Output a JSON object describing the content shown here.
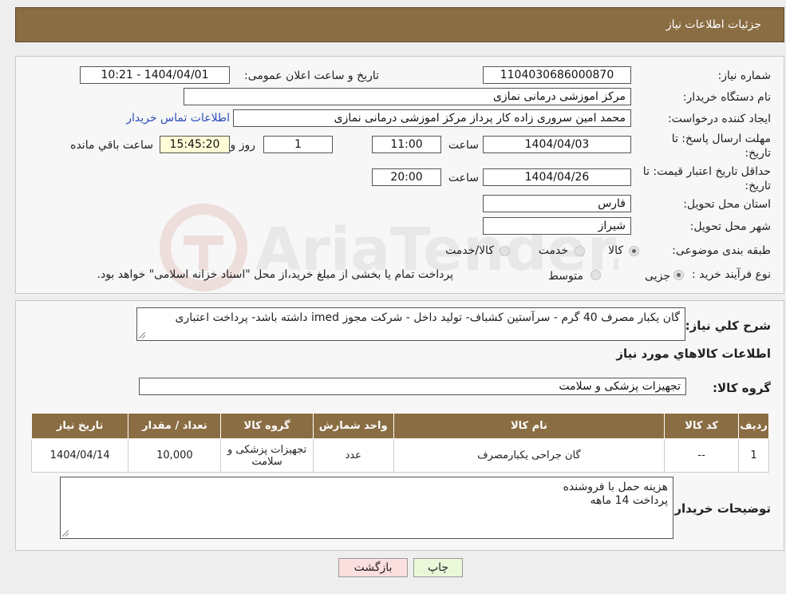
{
  "header": {
    "title": "جزئیات اطلاعات نیاز"
  },
  "form": {
    "need_number_label": "شماره نیاز:",
    "need_number": "1104030686000870",
    "announce_label": "تاریخ و ساعت اعلان عمومی:",
    "announce_value": "1404/04/01 - 10:21",
    "buyer_org_label": "نام دستگاه خریدار:",
    "buyer_org": "مرکز اموزشی درمانی نمازی",
    "requester_label": "ایجاد کننده درخواست:",
    "requester": "محمد امین سروری زاده کار پرداز مرکز اموزشی درمانی نمازی",
    "contact_link": "اطلاعات تماس خریدار",
    "reply_deadline_label": "مهلت ارسال پاسخ: تا تاریخ:",
    "reply_date": "1404/04/03",
    "time_label": "ساعت",
    "reply_time": "11:00",
    "days_value": "1",
    "days_label": "روز و",
    "remaining_time": "15:45:20",
    "remaining_label": "ساعت باقي مانده",
    "price_validity_label": "حداقل تاریخ اعتبار قیمت: تا تاریخ:",
    "validity_date": "1404/04/26",
    "validity_time": "20:00",
    "province_label": "استان محل تحویل:",
    "province": "فارس",
    "city_label": "شهر محل تحویل:",
    "city": "شیراز",
    "category_label": "طبقه بندی موضوعی:",
    "category_options": [
      "کالا",
      "خدمت",
      "کالا/خدمت"
    ],
    "process_label": "نوع فرآیند خرید :",
    "process_options": [
      "جزیی",
      "متوسط"
    ],
    "process_note": "پرداخت تمام یا بخشی از مبلغ خرید،از محل \"اسناد خزانه اسلامی\" خواهد بود."
  },
  "description": {
    "label": "شرح کلي نياز:",
    "text": "گان یکبار مصرف 40 گرم - سرآستین کشباف- تولید داخل - شرکت مجوز imed داشته باشد- پرداخت اعتباری"
  },
  "items_section": {
    "title": "اطلاعات کالاهاي مورد نياز",
    "group_label": "گروه کالا:",
    "group_value": "تجهیزات پزشکی و سلامت",
    "columns": [
      "ردیف",
      "کد کالا",
      "نام کالا",
      "واحد شمارش",
      "گروه کالا",
      "تعداد / مقدار",
      "تاریخ نیاز"
    ],
    "rows": [
      [
        "1",
        "--",
        "گان جراحی یکبارمصرف",
        "عدد",
        "تجهیزات پزشکی و سلامت",
        "10,000",
        "1404/04/14"
      ]
    ]
  },
  "buyer_notes": {
    "label": "توضیحات خریدار:",
    "line1": "هزینه حمل با فروشنده",
    "line2": "پرداخت 14 ماهه"
  },
  "buttons": {
    "print": "چاپ",
    "back": "بازگشت"
  },
  "watermark": {
    "text": "AriaTender.neT"
  },
  "colors": {
    "header_bg": "#8b6d43",
    "link": "#2a4dbd",
    "print_btn": "#eaf7d9",
    "back_btn": "#fbdede"
  }
}
